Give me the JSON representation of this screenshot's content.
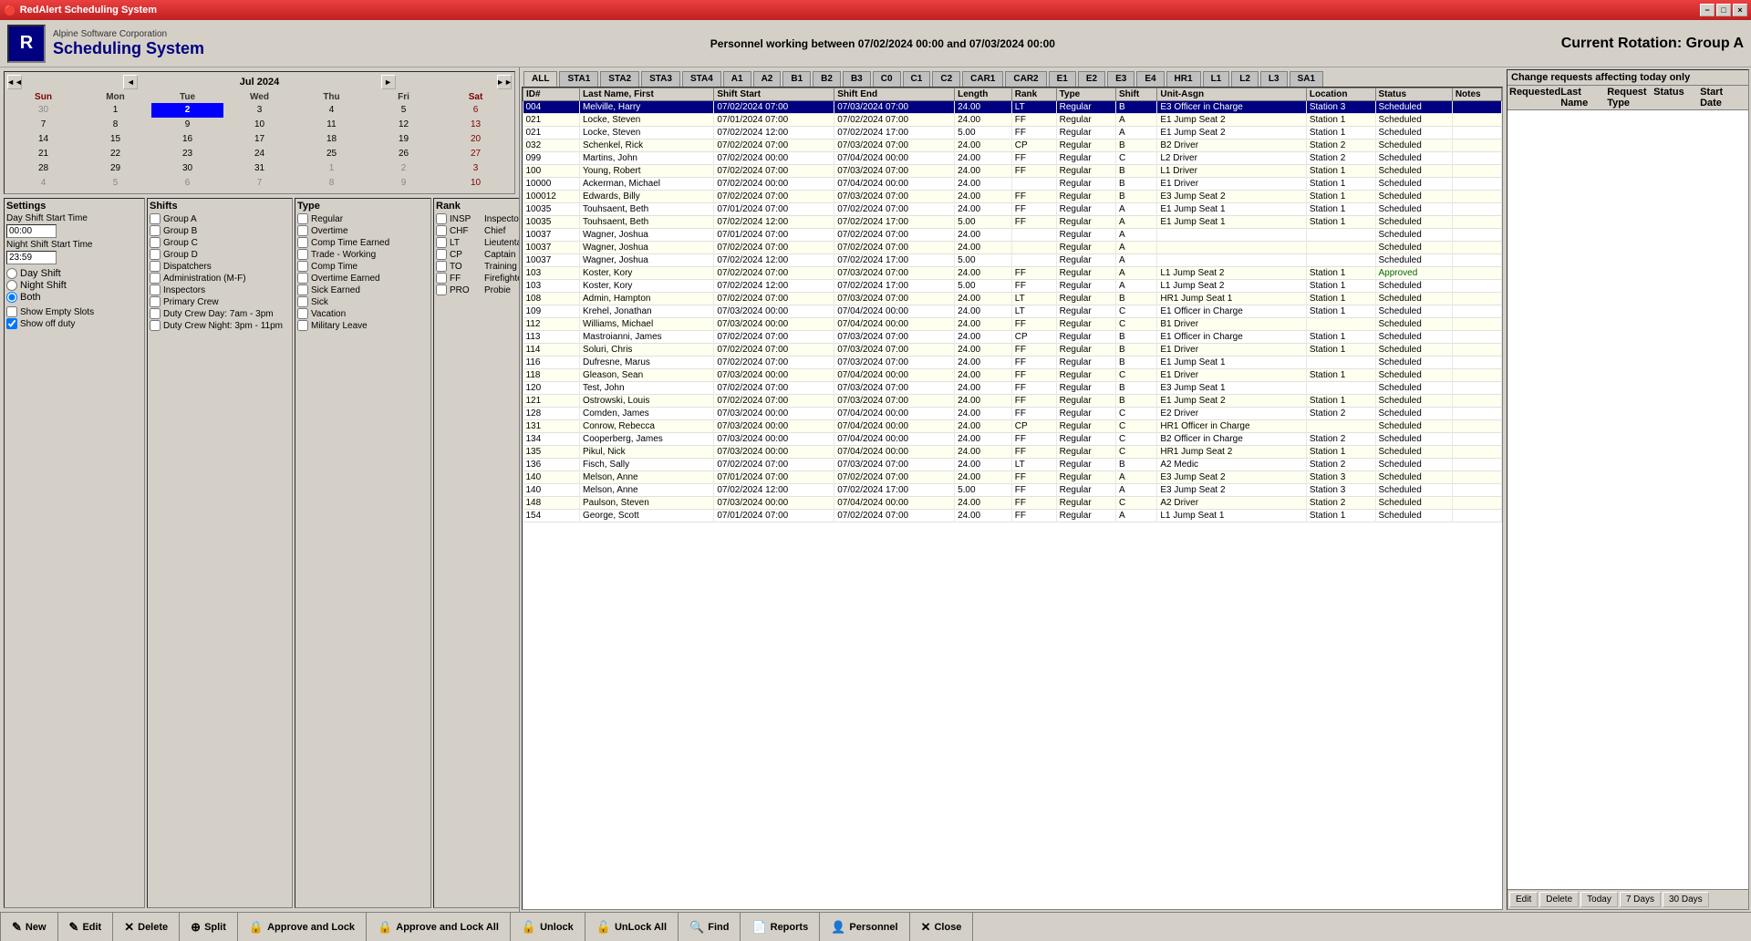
{
  "titleBar": {
    "title": "RedAlert Scheduling System",
    "minimizeLabel": "−",
    "maximizeLabel": "□",
    "closeLabel": "×"
  },
  "header": {
    "company": "Alpine Software Corporation",
    "title": "Scheduling System",
    "centerText": "Personnel working between 07/02/2024 00:00 and 07/03/2024 00:00",
    "rightText": "Current Rotation: Group A"
  },
  "calendar": {
    "monthYear": "Jul 2024",
    "dayHeaders": [
      "Sun",
      "Mon",
      "Tue",
      "Wed",
      "Thu",
      "Fri",
      "Sat"
    ],
    "weeks": [
      [
        {
          "day": "30",
          "other": true
        },
        {
          "day": "1"
        },
        {
          "day": "2",
          "today": true
        },
        {
          "day": "3"
        },
        {
          "day": "4"
        },
        {
          "day": "5"
        },
        {
          "day": "6",
          "weekend": true
        }
      ],
      [
        {
          "day": "7"
        },
        {
          "day": "8"
        },
        {
          "day": "9"
        },
        {
          "day": "10"
        },
        {
          "day": "11"
        },
        {
          "day": "12"
        },
        {
          "day": "13",
          "weekend": true
        }
      ],
      [
        {
          "day": "14"
        },
        {
          "day": "15"
        },
        {
          "day": "16"
        },
        {
          "day": "17"
        },
        {
          "day": "18"
        },
        {
          "day": "19"
        },
        {
          "day": "20",
          "weekend": true
        }
      ],
      [
        {
          "day": "21"
        },
        {
          "day": "22"
        },
        {
          "day": "23"
        },
        {
          "day": "24"
        },
        {
          "day": "25"
        },
        {
          "day": "26"
        },
        {
          "day": "27",
          "weekend": true
        }
      ],
      [
        {
          "day": "28"
        },
        {
          "day": "29"
        },
        {
          "day": "30"
        },
        {
          "day": "31"
        },
        {
          "day": "1",
          "other": true
        },
        {
          "day": "2",
          "other": true
        },
        {
          "day": "3",
          "other": true,
          "weekend": true
        }
      ],
      [
        {
          "day": "4",
          "other": true
        },
        {
          "day": "5",
          "other": true
        },
        {
          "day": "6",
          "other": true
        },
        {
          "day": "7",
          "other": true
        },
        {
          "day": "8",
          "other": true
        },
        {
          "day": "9",
          "other": true
        },
        {
          "day": "10",
          "other": true,
          "weekend": true
        }
      ]
    ]
  },
  "settings": {
    "title": "Settings",
    "dayShiftStartTime": "Day Shift Start Time",
    "dayShiftValue": "00:00",
    "nightShiftStartTime": "Night Shift Start Time",
    "nightShiftValue": "23:59",
    "dayShiftLabel": "Day Shift",
    "nightShiftLabel": "Night Shift",
    "bothLabel": "Both",
    "showEmptySlots": "Show Empty Slots",
    "showOffDuty": "Show off duty"
  },
  "shifts": {
    "title": "Shifts",
    "items": [
      {
        "id": "A",
        "label": "Group A"
      },
      {
        "id": "B",
        "label": "Group B"
      },
      {
        "id": "C",
        "label": "Group C"
      },
      {
        "id": "D",
        "label": "Group D"
      },
      {
        "id": "DISP",
        "label": "Dispatchers"
      },
      {
        "id": "ADM",
        "label": "Administration (M-F)"
      },
      {
        "id": "INSP",
        "label": "Inspectors"
      },
      {
        "id": "PC",
        "label": "Primary Crew"
      },
      {
        "id": "DCAM",
        "label": "Duty Crew Day: 7am - 3pm"
      },
      {
        "id": "DCPM",
        "label": "Duty Crew Night: 3pm - 11pm"
      }
    ]
  },
  "types": {
    "title": "Type",
    "items": [
      {
        "id": "REG",
        "label": "Regular"
      },
      {
        "id": "OT",
        "label": "Overtime"
      },
      {
        "id": "CTE",
        "label": "Comp Time Earned"
      },
      {
        "id": "TW",
        "label": "Trade - Working"
      },
      {
        "id": "CT",
        "label": "Comp Time"
      },
      {
        "id": "OTE",
        "label": "Overtime Earned"
      },
      {
        "id": "SICKE",
        "label": "Sick Earned"
      },
      {
        "id": "SICK",
        "label": "Sick"
      },
      {
        "id": "VAC",
        "label": "Vacation"
      },
      {
        "id": "ML",
        "label": "Military Leave"
      }
    ]
  },
  "ranks": {
    "title": "Rank",
    "items": [
      {
        "id": "INSP",
        "label": "Inspector"
      },
      {
        "id": "CHF",
        "label": "Chief"
      },
      {
        "id": "LT",
        "label": "Lieutentant"
      },
      {
        "id": "CP",
        "label": "Captain"
      },
      {
        "id": "TO",
        "label": "Training Officer"
      },
      {
        "id": "FF",
        "label": "Firefighter"
      },
      {
        "id": "PRO",
        "label": "Probie"
      }
    ]
  },
  "changeRequests": {
    "title": "Change requests affecting today only",
    "columns": [
      "Requested",
      "Last Name",
      "Request Type",
      "Status",
      "Start Date"
    ],
    "editLabel": "Edit",
    "deleteLabel": "Delete",
    "todayLabel": "Today",
    "sevenDaysLabel": "7 Days",
    "thirtyDaysLabel": "30 Days"
  },
  "tabs": [
    "ALL",
    "STA1",
    "STA2",
    "STA3",
    "STA4",
    "A1",
    "A2",
    "B1",
    "B2",
    "B3",
    "C0",
    "C1",
    "C2",
    "CAR1",
    "CAR2",
    "E1",
    "E2",
    "E3",
    "E4",
    "HR1",
    "L1",
    "L2",
    "L3",
    "SA1"
  ],
  "tableColumns": [
    "ID#",
    "Last Name, First",
    "Shift Start",
    "Shift End",
    "Length",
    "Rank",
    "Type",
    "Shift",
    "Unit-Asgn",
    "Location",
    "Status",
    "Notes"
  ],
  "tableRows": [
    {
      "id": "004",
      "name": "Melville, Harry",
      "shiftStart": "07/02/2024 07:00",
      "shiftEnd": "07/03/2024 07:00",
      "length": "24.00",
      "rank": "LT",
      "type": "Regular",
      "shift": "B",
      "unit": "E3 Officer in Charge",
      "location": "Station 3",
      "status": "Scheduled",
      "notes": "",
      "selected": true
    },
    {
      "id": "021",
      "name": "Locke, Steven",
      "shiftStart": "07/01/2024 07:00",
      "shiftEnd": "07/02/2024 07:00",
      "length": "24.00",
      "rank": "FF",
      "type": "Regular",
      "shift": "A",
      "unit": "E1 Jump Seat 2",
      "location": "Station 1",
      "status": "Scheduled",
      "notes": ""
    },
    {
      "id": "021",
      "name": "Locke, Steven",
      "shiftStart": "07/02/2024 12:00",
      "shiftEnd": "07/02/2024 17:00",
      "length": "5.00",
      "rank": "FF",
      "type": "Regular",
      "shift": "A",
      "unit": "E1 Jump Seat 2",
      "location": "Station 1",
      "status": "Scheduled",
      "notes": ""
    },
    {
      "id": "032",
      "name": "Schenkel, Rick",
      "shiftStart": "07/02/2024 07:00",
      "shiftEnd": "07/03/2024 07:00",
      "length": "24.00",
      "rank": "CP",
      "type": "Regular",
      "shift": "B",
      "unit": "B2 Driver",
      "location": "Station 2",
      "status": "Scheduled",
      "notes": ""
    },
    {
      "id": "099",
      "name": "Martins, John",
      "shiftStart": "07/02/2024 00:00",
      "shiftEnd": "07/04/2024 00:00",
      "length": "24.00",
      "rank": "FF",
      "type": "Regular",
      "shift": "C",
      "unit": "L2 Driver",
      "location": "Station 2",
      "status": "Scheduled",
      "notes": ""
    },
    {
      "id": "100",
      "name": "Young, Robert",
      "shiftStart": "07/02/2024 07:00",
      "shiftEnd": "07/03/2024 07:00",
      "length": "24.00",
      "rank": "FF",
      "type": "Regular",
      "shift": "B",
      "unit": "L1 Driver",
      "location": "Station 1",
      "status": "Scheduled",
      "notes": ""
    },
    {
      "id": "10000",
      "name": "Ackerman, Michael",
      "shiftStart": "07/02/2024 00:00",
      "shiftEnd": "07/04/2024 00:00",
      "length": "24.00",
      "rank": "",
      "type": "Regular",
      "shift": "B",
      "unit": "E1 Driver",
      "location": "Station 1",
      "status": "Scheduled",
      "notes": ""
    },
    {
      "id": "100012",
      "name": "Edwards, Billy",
      "shiftStart": "07/02/2024 07:00",
      "shiftEnd": "07/03/2024 07:00",
      "length": "24.00",
      "rank": "FF",
      "type": "Regular",
      "shift": "B",
      "unit": "E3 Jump Seat 2",
      "location": "Station 1",
      "status": "Scheduled",
      "notes": ""
    },
    {
      "id": "10035",
      "name": "Touhsaent, Beth",
      "shiftStart": "07/01/2024 07:00",
      "shiftEnd": "07/02/2024 07:00",
      "length": "24.00",
      "rank": "FF",
      "type": "Regular",
      "shift": "A",
      "unit": "E1 Jump Seat 1",
      "location": "Station 1",
      "status": "Scheduled",
      "notes": ""
    },
    {
      "id": "10035",
      "name": "Touhsaent, Beth",
      "shiftStart": "07/02/2024 12:00",
      "shiftEnd": "07/02/2024 17:00",
      "length": "5.00",
      "rank": "FF",
      "type": "Regular",
      "shift": "A",
      "unit": "E1 Jump Seat 1",
      "location": "Station 1",
      "status": "Scheduled",
      "notes": ""
    },
    {
      "id": "10037",
      "name": "Wagner, Joshua",
      "shiftStart": "07/01/2024 07:00",
      "shiftEnd": "07/02/2024 07:00",
      "length": "24.00",
      "rank": "",
      "type": "Regular",
      "shift": "A",
      "unit": "",
      "location": "",
      "status": "Scheduled",
      "notes": ""
    },
    {
      "id": "10037",
      "name": "Wagner, Joshua",
      "shiftStart": "07/02/2024 07:00",
      "shiftEnd": "07/02/2024 07:00",
      "length": "24.00",
      "rank": "",
      "type": "Regular",
      "shift": "A",
      "unit": "",
      "location": "",
      "status": "Scheduled",
      "notes": ""
    },
    {
      "id": "10037",
      "name": "Wagner, Joshua",
      "shiftStart": "07/02/2024 12:00",
      "shiftEnd": "07/02/2024 17:00",
      "length": "5.00",
      "rank": "",
      "type": "Regular",
      "shift": "A",
      "unit": "",
      "location": "",
      "status": "Scheduled",
      "notes": ""
    },
    {
      "id": "103",
      "name": "Koster, Kory",
      "shiftStart": "07/02/2024 07:00",
      "shiftEnd": "07/03/2024 07:00",
      "length": "24.00",
      "rank": "FF",
      "type": "Regular",
      "shift": "A",
      "unit": "L1 Jump Seat 2",
      "location": "Station 1",
      "status": "Approved",
      "notes": ""
    },
    {
      "id": "103",
      "name": "Koster, Kory",
      "shiftStart": "07/02/2024 12:00",
      "shiftEnd": "07/02/2024 17:00",
      "length": "5.00",
      "rank": "FF",
      "type": "Regular",
      "shift": "A",
      "unit": "L1 Jump Seat 2",
      "location": "Station 1",
      "status": "Scheduled",
      "notes": ""
    },
    {
      "id": "108",
      "name": "Admin, Hampton",
      "shiftStart": "07/02/2024 07:00",
      "shiftEnd": "07/03/2024 07:00",
      "length": "24.00",
      "rank": "LT",
      "type": "Regular",
      "shift": "B",
      "unit": "HR1 Jump Seat 1",
      "location": "Station 1",
      "status": "Scheduled",
      "notes": ""
    },
    {
      "id": "109",
      "name": "Krehel, Jonathan",
      "shiftStart": "07/03/2024 00:00",
      "shiftEnd": "07/04/2024 00:00",
      "length": "24.00",
      "rank": "LT",
      "type": "Regular",
      "shift": "C",
      "unit": "E1 Officer in Charge",
      "location": "Station 1",
      "status": "Scheduled",
      "notes": ""
    },
    {
      "id": "112",
      "name": "Williams, Michael",
      "shiftStart": "07/03/2024 00:00",
      "shiftEnd": "07/04/2024 00:00",
      "length": "24.00",
      "rank": "FF",
      "type": "Regular",
      "shift": "C",
      "unit": "B1 Driver",
      "location": "",
      "status": "Scheduled",
      "notes": ""
    },
    {
      "id": "113",
      "name": "Mastroianni, James",
      "shiftStart": "07/02/2024 07:00",
      "shiftEnd": "07/03/2024 07:00",
      "length": "24.00",
      "rank": "CP",
      "type": "Regular",
      "shift": "B",
      "unit": "E1 Officer in Charge",
      "location": "Station 1",
      "status": "Scheduled",
      "notes": ""
    },
    {
      "id": "114",
      "name": "Soluri, Chris",
      "shiftStart": "07/02/2024 07:00",
      "shiftEnd": "07/03/2024 07:00",
      "length": "24.00",
      "rank": "FF",
      "type": "Regular",
      "shift": "B",
      "unit": "E1 Driver",
      "location": "Station 1",
      "status": "Scheduled",
      "notes": ""
    },
    {
      "id": "116",
      "name": "Dufresne, Marus",
      "shiftStart": "07/02/2024 07:00",
      "shiftEnd": "07/03/2024 07:00",
      "length": "24.00",
      "rank": "FF",
      "type": "Regular",
      "shift": "B",
      "unit": "E1 Jump Seat 1",
      "location": "",
      "status": "Scheduled",
      "notes": ""
    },
    {
      "id": "118",
      "name": "Gleason, Sean",
      "shiftStart": "07/03/2024 00:00",
      "shiftEnd": "07/04/2024 00:00",
      "length": "24.00",
      "rank": "FF",
      "type": "Regular",
      "shift": "C",
      "unit": "E1 Driver",
      "location": "Station 1",
      "status": "Scheduled",
      "notes": ""
    },
    {
      "id": "120",
      "name": "Test, John",
      "shiftStart": "07/02/2024 07:00",
      "shiftEnd": "07/03/2024 07:00",
      "length": "24.00",
      "rank": "FF",
      "type": "Regular",
      "shift": "B",
      "unit": "E3 Jump Seat 1",
      "location": "",
      "status": "Scheduled",
      "notes": ""
    },
    {
      "id": "121",
      "name": "Ostrowski, Louis",
      "shiftStart": "07/02/2024 07:00",
      "shiftEnd": "07/03/2024 07:00",
      "length": "24.00",
      "rank": "FF",
      "type": "Regular",
      "shift": "B",
      "unit": "E1 Jump Seat 2",
      "location": "Station 1",
      "status": "Scheduled",
      "notes": ""
    },
    {
      "id": "128",
      "name": "Comden, James",
      "shiftStart": "07/03/2024 00:00",
      "shiftEnd": "07/04/2024 00:00",
      "length": "24.00",
      "rank": "FF",
      "type": "Regular",
      "shift": "C",
      "unit": "E2 Driver",
      "location": "Station 2",
      "status": "Scheduled",
      "notes": ""
    },
    {
      "id": "131",
      "name": "Conrow, Rebecca",
      "shiftStart": "07/03/2024 00:00",
      "shiftEnd": "07/04/2024 00:00",
      "length": "24.00",
      "rank": "CP",
      "type": "Regular",
      "shift": "C",
      "unit": "HR1 Officer in Charge",
      "location": "",
      "status": "Scheduled",
      "notes": ""
    },
    {
      "id": "134",
      "name": "Cooperberg, James",
      "shiftStart": "07/03/2024 00:00",
      "shiftEnd": "07/04/2024 00:00",
      "length": "24.00",
      "rank": "FF",
      "type": "Regular",
      "shift": "C",
      "unit": "B2 Officer in Charge",
      "location": "Station 2",
      "status": "Scheduled",
      "notes": ""
    },
    {
      "id": "135",
      "name": "Pikul, Nick",
      "shiftStart": "07/03/2024 00:00",
      "shiftEnd": "07/04/2024 00:00",
      "length": "24.00",
      "rank": "FF",
      "type": "Regular",
      "shift": "C",
      "unit": "HR1 Jump Seat 2",
      "location": "Station 1",
      "status": "Scheduled",
      "notes": ""
    },
    {
      "id": "136",
      "name": "Fisch, Sally",
      "shiftStart": "07/02/2024 07:00",
      "shiftEnd": "07/03/2024 07:00",
      "length": "24.00",
      "rank": "LT",
      "type": "Regular",
      "shift": "B",
      "unit": "A2 Medic",
      "location": "Station 2",
      "status": "Scheduled",
      "notes": ""
    },
    {
      "id": "140",
      "name": "Melson, Anne",
      "shiftStart": "07/01/2024 07:00",
      "shiftEnd": "07/02/2024 07:00",
      "length": "24.00",
      "rank": "FF",
      "type": "Regular",
      "shift": "A",
      "unit": "E3 Jump Seat 2",
      "location": "Station 3",
      "status": "Scheduled",
      "notes": ""
    },
    {
      "id": "140",
      "name": "Melson, Anne",
      "shiftStart": "07/02/2024 12:00",
      "shiftEnd": "07/02/2024 17:00",
      "length": "5.00",
      "rank": "FF",
      "type": "Regular",
      "shift": "A",
      "unit": "E3 Jump Seat 2",
      "location": "Station 3",
      "status": "Scheduled",
      "notes": ""
    },
    {
      "id": "148",
      "name": "Paulson, Steven",
      "shiftStart": "07/03/2024 00:00",
      "shiftEnd": "07/04/2024 00:00",
      "length": "24.00",
      "rank": "FF",
      "type": "Regular",
      "shift": "C",
      "unit": "A2 Driver",
      "location": "Station 2",
      "status": "Scheduled",
      "notes": ""
    },
    {
      "id": "154",
      "name": "George, Scott",
      "shiftStart": "07/01/2024 07:00",
      "shiftEnd": "07/02/2024 07:00",
      "length": "24.00",
      "rank": "FF",
      "type": "Regular",
      "shift": "A",
      "unit": "L1 Jump Seat 1",
      "location": "Station 1",
      "status": "Scheduled",
      "notes": ""
    }
  ],
  "bottomButtons": [
    {
      "label": "New",
      "icon": "✎",
      "name": "new-button"
    },
    {
      "label": "Edit",
      "icon": "✎",
      "name": "edit-button"
    },
    {
      "label": "Delete",
      "icon": "✕",
      "name": "delete-button"
    },
    {
      "label": "Split",
      "icon": "⊕",
      "name": "split-button"
    },
    {
      "label": "Approve and Lock",
      "icon": "🔒",
      "name": "approve-lock-button"
    },
    {
      "label": "Approve and Lock All",
      "icon": "🔒",
      "name": "approve-lock-all-button"
    },
    {
      "label": "Unlock",
      "icon": "🔓",
      "name": "unlock-button"
    },
    {
      "label": "UnLock All",
      "icon": "🔓",
      "name": "unlock-all-button"
    },
    {
      "label": "Find",
      "icon": "🔍",
      "name": "find-button"
    },
    {
      "label": "Reports",
      "icon": "📄",
      "name": "reports-button"
    },
    {
      "label": "Personnel",
      "icon": "👤",
      "name": "personnel-button"
    },
    {
      "label": "Close",
      "icon": "✕",
      "name": "close-button"
    }
  ]
}
